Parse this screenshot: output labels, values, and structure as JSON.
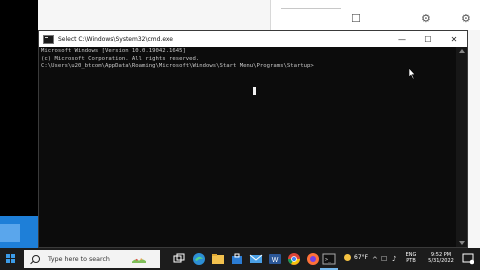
{
  "window": {
    "title": "Select C:\\Windows\\System32\\cmd.exe",
    "controls": {
      "minimize": "—",
      "maximize": "☐",
      "close": "✕"
    }
  },
  "console": {
    "lines": [
      "Microsoft Windows [Version 10.0.19042.1645]",
      "(c) Microsoft Corporation. All rights reserved.",
      "",
      "C:\\Users\\u20_btcom\\AppData\\Roaming\\Microsoft\\Windows\\Start Menu\\Programs\\Startup>"
    ]
  },
  "taskbar": {
    "search_placeholder": "Type here to search",
    "weather": {
      "temp": "67°F",
      "icon": "sun-icon"
    },
    "language": {
      "line1": "ENG",
      "line2": "PTB"
    },
    "clock": {
      "time": "9:52 PM",
      "date": "5/31/2022"
    },
    "apps": [
      "task-view-icon",
      "edge-icon",
      "file-explorer-icon",
      "store-icon",
      "mail-icon",
      "word-icon",
      "excel-icon",
      "chrome-icon",
      "firefox-icon",
      "app-icon",
      "cmd-icon"
    ]
  },
  "colors": {
    "console_bg": "#0c0c0c",
    "console_text": "#c8c8c8",
    "taskbar_bg": "#1c1c1c",
    "accent": "#1e7fd8"
  }
}
